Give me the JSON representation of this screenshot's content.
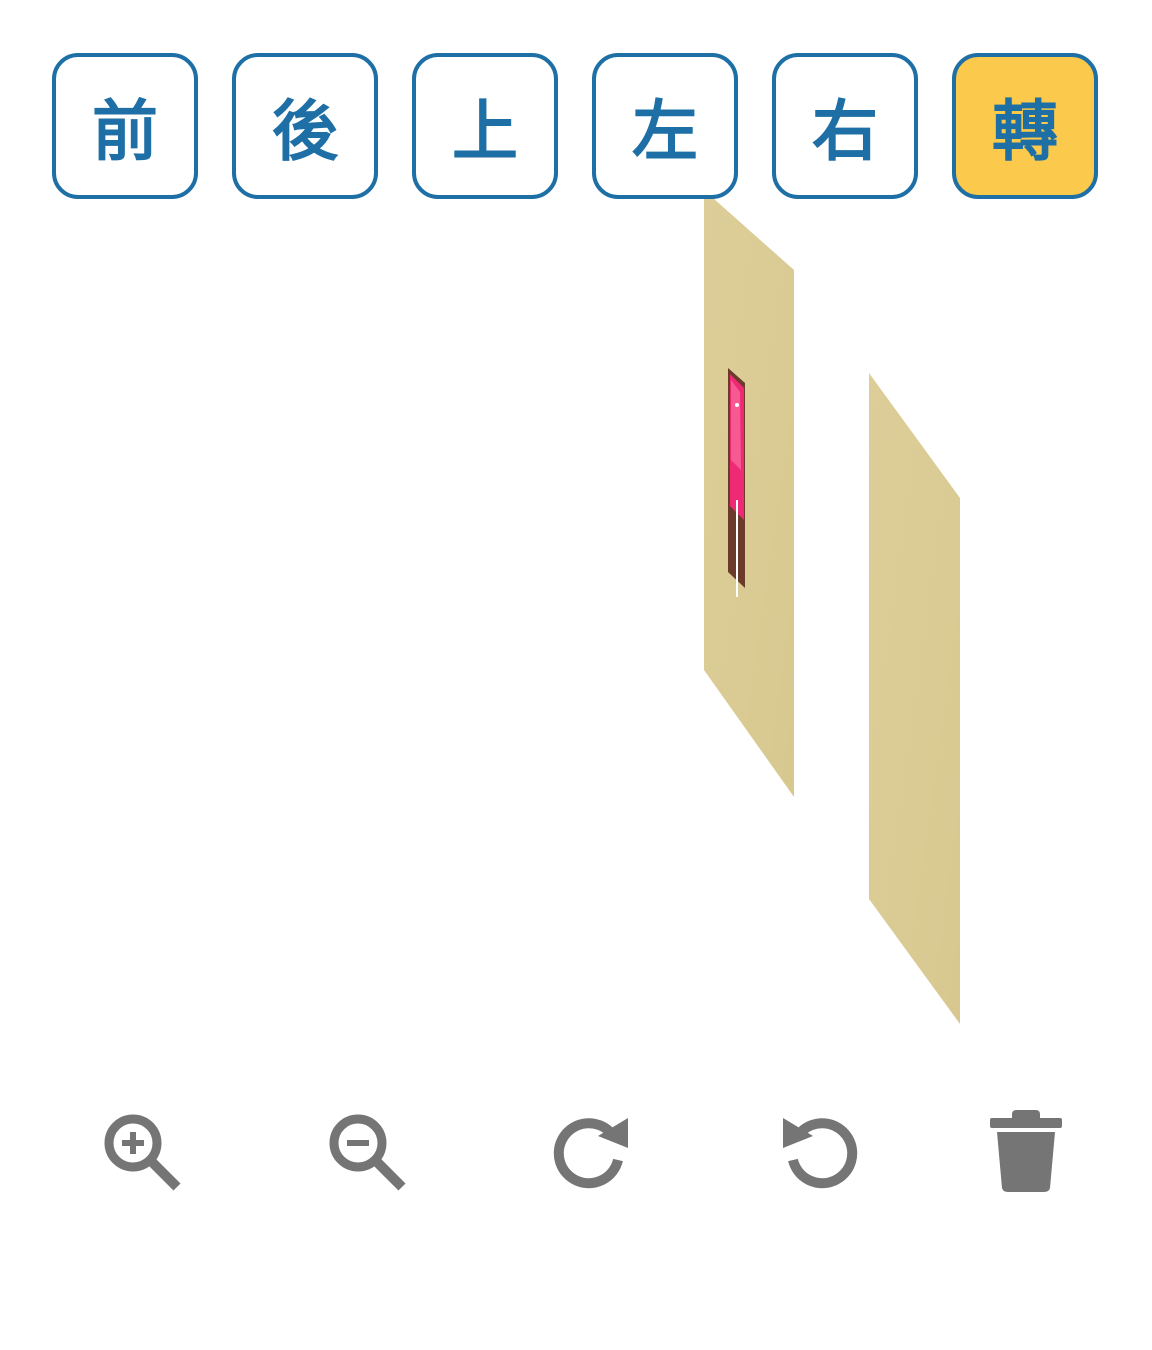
{
  "view_buttons": {
    "front": "前",
    "back": "後",
    "top": "上",
    "left": "左",
    "right": "右",
    "rotate": "轉"
  },
  "active_view": "rotate",
  "colors": {
    "button_border": "#1d6fa5",
    "button_text": "#1d6fa5",
    "active_button_bg": "#fbc94b",
    "panel": "#dccb95",
    "picture_pink": "#ef2a74",
    "picture_frame": "#6b3a2a",
    "icon_gray": "#757575"
  },
  "toolbar": {
    "zoom_in_icon": "zoom-in-icon",
    "zoom_out_icon": "zoom-out-icon",
    "rotate_cw_icon": "rotate-clockwise-icon",
    "rotate_ccw_icon": "rotate-counterclockwise-icon",
    "delete_icon": "trash-icon"
  }
}
